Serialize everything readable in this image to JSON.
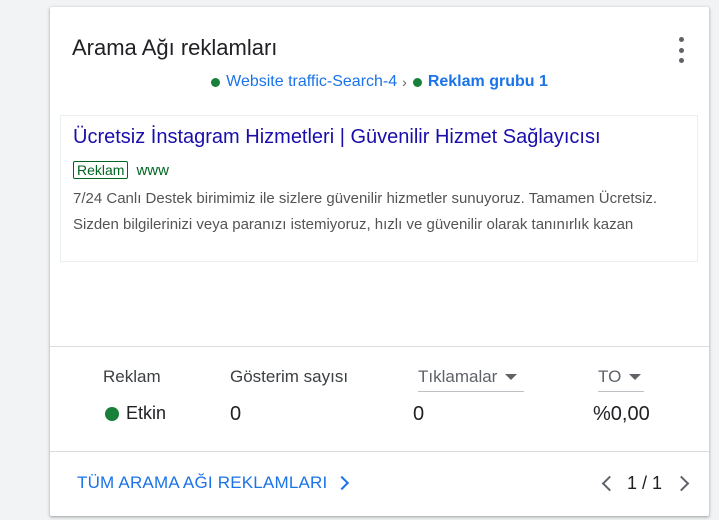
{
  "card": {
    "title": "Arama Ağı reklamları",
    "more_icon": "more-vert-icon"
  },
  "breadcrumb": {
    "campaign": "Website traffic-Search-4",
    "separator": "›",
    "ad_group": "Reklam grubu 1",
    "status_color": "#188038"
  },
  "ad": {
    "headline": "Ücretsiz İnstagram Hizmetleri | Güvenilir Hizmet Sağlayıcısı",
    "badge": "Reklam",
    "url": "www",
    "description": "7/24 Canlı Destek birimimiz ile sizlere güvenilir hizmetler sunuyoruz. Tamamen Ücretsiz. Sizden bilgilerinizi veya paranızı istemiyoruz, hızlı ve güvenilir olarak tanınırlık kazan"
  },
  "stats": {
    "headers": {
      "ad": "Reklam",
      "impressions": "Gösterim sayısı",
      "clicks": "Tıklamalar",
      "ctr": "TO"
    },
    "values": {
      "status": "Etkin",
      "impressions": "0",
      "clicks": "0",
      "ctr": "%0,00"
    }
  },
  "footer": {
    "all_ads_link": "TÜM ARAMA AĞI REKLAMLARI",
    "pagination": "1 / 1"
  },
  "colors": {
    "accent": "#1a73e8",
    "headline": "#1a0dab",
    "green": "#188038"
  }
}
